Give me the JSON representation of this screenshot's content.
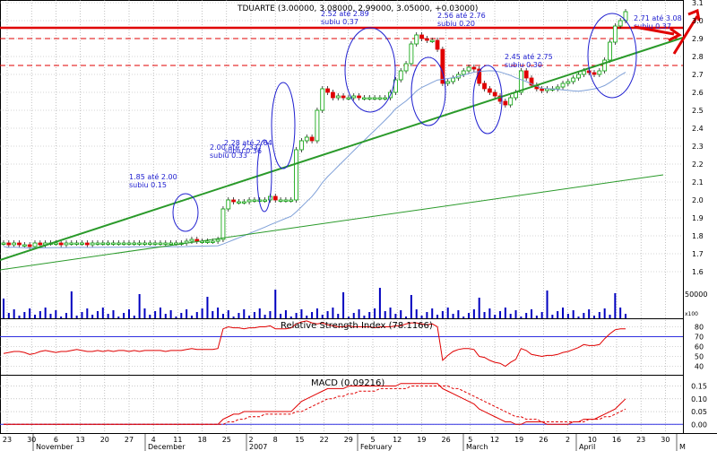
{
  "chart_data": {
    "type": "candlestick",
    "title": "TDUARTE (3.00000, 3.08000, 2.99000, 3.05000, +0.03000)",
    "price_axis": {
      "ylim": [
        1.6,
        3.2
      ],
      "ticks": [
        1.6,
        1.7,
        1.8,
        1.9,
        2.0,
        2.1,
        2.2,
        2.3,
        2.4,
        2.5,
        2.6,
        2.7,
        2.8,
        2.9,
        3.0,
        3.1
      ]
    },
    "volume_axis": {
      "labels": [
        "50000",
        "x100"
      ]
    },
    "x_axis": {
      "day_labels": [
        "23",
        "30",
        "6",
        "13",
        "20",
        "27",
        "4",
        "11",
        "18",
        "25",
        "2",
        "8",
        "15",
        "22",
        "29",
        "5",
        "12",
        "19",
        "26",
        "5",
        "12",
        "19",
        "26",
        "2",
        "10",
        "16",
        "23",
        "30"
      ],
      "month_labels": [
        "November",
        "December",
        "2007",
        "February",
        "March",
        "April",
        "M"
      ]
    },
    "series": [
      {
        "name": "Price",
        "values": [
          1.76,
          1.75,
          1.76,
          1.75,
          1.75,
          1.74,
          1.76,
          1.75,
          1.76,
          1.76,
          1.76,
          1.75,
          1.76,
          1.76,
          1.76,
          1.76,
          1.75,
          1.76,
          1.76,
          1.76,
          1.76,
          1.76,
          1.76,
          1.76,
          1.76,
          1.76,
          1.76,
          1.76,
          1.76,
          1.76,
          1.76,
          1.76,
          1.76,
          1.76,
          1.76,
          1.77,
          1.78,
          1.77,
          1.77,
          1.77,
          1.77,
          1.78,
          1.95,
          2.0,
          1.99,
          1.99,
          1.99,
          2.0,
          2.0,
          2.0,
          2.0,
          2.02,
          2.0,
          2.0,
          2.0,
          2.0,
          2.28,
          2.33,
          2.35,
          2.33,
          2.5,
          2.62,
          2.6,
          2.57,
          2.58,
          2.57,
          2.57,
          2.58,
          2.57,
          2.57,
          2.57,
          2.57,
          2.57,
          2.57,
          2.6,
          2.67,
          2.72,
          2.76,
          2.87,
          2.92,
          2.9,
          2.89,
          2.89,
          2.84,
          2.65,
          2.66,
          2.68,
          2.7,
          2.72,
          2.74,
          2.73,
          2.65,
          2.62,
          2.6,
          2.58,
          2.55,
          2.53,
          2.57,
          2.6,
          2.72,
          2.68,
          2.64,
          2.62,
          2.61,
          2.62,
          2.62,
          2.63,
          2.65,
          2.66,
          2.68,
          2.7,
          2.72,
          2.71,
          2.7,
          2.72,
          2.78,
          2.88,
          2.97,
          3.0,
          3.05
        ]
      }
    ],
    "price_levels": [
      {
        "name": "resistance",
        "value": 2.96,
        "style": "solid",
        "color": "#e00000"
      },
      {
        "name": "dashed-1",
        "value": 2.9,
        "style": "dashed",
        "color": "#e00000"
      },
      {
        "name": "dashed-2",
        "value": 2.75,
        "style": "dashed",
        "color": "#e00000"
      }
    ],
    "annotations": [
      {
        "line1": "1.85 até 2.00",
        "line2": "subiu 0.15"
      },
      {
        "line1": "2.00 até 2.33",
        "line2": "subiu 0.33"
      },
      {
        "line1": "2.28 até 2.64",
        "line2": "subiu 0.36"
      },
      {
        "line1": "2.52 até 2.89",
        "line2": "subiu 0.37"
      },
      {
        "line1": "2.56 até 2.76",
        "line2": "subiu 0.20"
      },
      {
        "line1": "2.45 até 2.75",
        "line2": "subiu 0.30"
      },
      {
        "line1": "2.71 até 3.08",
        "line2": "subiu 0.37"
      }
    ],
    "indicators": [
      {
        "name": "Relative Strength Index (78.1166)",
        "ylim": [
          35,
          85
        ],
        "ticks": [
          40,
          50,
          60,
          70,
          80
        ],
        "reference": 70,
        "values": [
          53,
          54,
          55,
          55,
          54,
          52,
          53,
          55,
          56,
          55,
          54,
          55,
          55,
          56,
          57,
          56,
          55,
          55,
          56,
          55,
          56,
          55,
          56,
          56,
          55,
          56,
          55,
          56,
          56,
          56,
          56,
          55,
          56,
          56,
          56,
          57,
          58,
          57,
          57,
          57,
          57,
          58,
          78,
          80,
          79,
          79,
          78,
          79,
          79,
          80,
          80,
          81,
          78,
          78,
          78,
          79,
          83,
          85,
          86,
          84,
          83,
          84,
          82,
          81,
          80,
          80,
          81,
          80,
          80,
          80,
          80,
          79,
          80,
          80,
          80,
          81,
          81,
          83,
          84,
          84,
          83,
          82,
          83,
          80,
          46,
          51,
          55,
          57,
          58,
          58,
          57,
          50,
          49,
          46,
          44,
          43,
          40,
          44,
          47,
          58,
          56,
          52,
          51,
          50,
          51,
          51,
          52,
          54,
          55,
          57,
          59,
          62,
          61,
          61,
          62,
          68,
          73,
          77,
          78,
          78
        ]
      },
      {
        "name": "MACD (0.09216)",
        "ylim": [
          -0.02,
          0.18
        ],
        "ticks": [
          0.0,
          0.05,
          0.1,
          0.15
        ],
        "macd": [
          0.0,
          0.0,
          0.0,
          0.0,
          0.0,
          0.0,
          0.0,
          0.0,
          0.0,
          0.0,
          0.0,
          0.0,
          0.0,
          0.0,
          0.0,
          0.0,
          0.0,
          0.0,
          0.0,
          0.0,
          0.0,
          0.0,
          0.0,
          0.0,
          0.0,
          0.0,
          0.0,
          0.0,
          0.0,
          0.0,
          0.0,
          0.0,
          0.0,
          0.0,
          0.0,
          0.0,
          0.0,
          0.0,
          0.0,
          0.0,
          0.0,
          0.0,
          0.02,
          0.03,
          0.04,
          0.04,
          0.05,
          0.05,
          0.05,
          0.05,
          0.05,
          0.05,
          0.05,
          0.05,
          0.05,
          0.05,
          0.07,
          0.09,
          0.1,
          0.11,
          0.12,
          0.13,
          0.14,
          0.14,
          0.14,
          0.14,
          0.15,
          0.15,
          0.15,
          0.15,
          0.15,
          0.15,
          0.15,
          0.15,
          0.15,
          0.15,
          0.16,
          0.16,
          0.16,
          0.16,
          0.16,
          0.16,
          0.16,
          0.16,
          0.14,
          0.13,
          0.12,
          0.11,
          0.1,
          0.09,
          0.08,
          0.06,
          0.05,
          0.04,
          0.03,
          0.02,
          0.01,
          0.01,
          0.0,
          0.0,
          0.01,
          0.01,
          0.01,
          0.01,
          0.0,
          0.0,
          0.0,
          0.0,
          0.0,
          0.01,
          0.01,
          0.02,
          0.02,
          0.02,
          0.03,
          0.04,
          0.05,
          0.06,
          0.08,
          0.1
        ],
        "signal": [
          0.0,
          0.0,
          0.0,
          0.0,
          0.0,
          0.0,
          0.0,
          0.0,
          0.0,
          0.0,
          0.0,
          0.0,
          0.0,
          0.0,
          0.0,
          0.0,
          0.0,
          0.0,
          0.0,
          0.0,
          0.0,
          0.0,
          0.0,
          0.0,
          0.0,
          0.0,
          0.0,
          0.0,
          0.0,
          0.0,
          0.0,
          0.0,
          0.0,
          0.0,
          0.0,
          0.0,
          0.0,
          0.0,
          0.0,
          0.0,
          0.0,
          0.0,
          0.0,
          0.01,
          0.01,
          0.02,
          0.02,
          0.03,
          0.03,
          0.03,
          0.04,
          0.04,
          0.04,
          0.04,
          0.04,
          0.04,
          0.05,
          0.05,
          0.06,
          0.07,
          0.08,
          0.09,
          0.1,
          0.1,
          0.11,
          0.11,
          0.12,
          0.12,
          0.13,
          0.13,
          0.13,
          0.13,
          0.14,
          0.14,
          0.14,
          0.14,
          0.14,
          0.14,
          0.15,
          0.15,
          0.15,
          0.15,
          0.15,
          0.15,
          0.15,
          0.15,
          0.14,
          0.14,
          0.13,
          0.12,
          0.11,
          0.1,
          0.09,
          0.08,
          0.07,
          0.06,
          0.05,
          0.04,
          0.03,
          0.03,
          0.02,
          0.02,
          0.02,
          0.01,
          0.01,
          0.01,
          0.01,
          0.01,
          0.01,
          0.01,
          0.01,
          0.01,
          0.02,
          0.02,
          0.02,
          0.03,
          0.03,
          0.04,
          0.05,
          0.06
        ]
      }
    ]
  }
}
